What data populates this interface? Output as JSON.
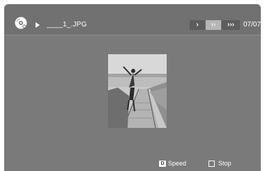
{
  "header": {
    "filename": "____1_.JPG",
    "counter": "07/07",
    "speed_buttons": [
      {
        "label": "›",
        "selected": false
      },
      {
        "label": "››",
        "selected": true
      },
      {
        "label": "›››",
        "selected": false
      }
    ]
  },
  "footer": {
    "speed_key": "D",
    "speed_label": "Speed",
    "stop_label": "Stop"
  },
  "colors": {
    "screen_bg": "#7a7a7a",
    "topbar_bg": "#717171",
    "button_bg": "#5d5d5d",
    "button_selected_bg": "#b6b6b6"
  },
  "icons": [
    "disc-icon",
    "play-icon",
    "stop-icon"
  ]
}
